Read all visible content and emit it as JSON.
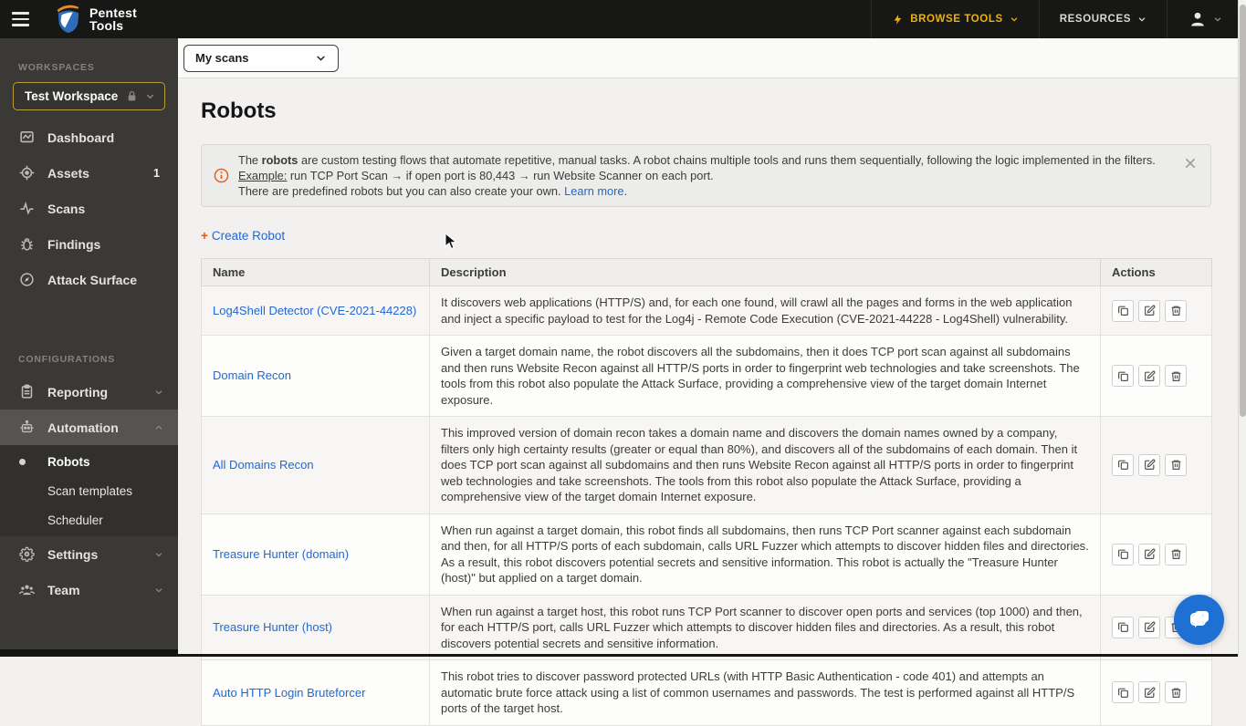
{
  "navbar": {
    "logo_line1": "Pentest",
    "logo_line2": "Tools",
    "browse_tools_label": "BROWSE TOOLS",
    "resources_label": "RESOURCES"
  },
  "sidebar": {
    "workspaces_label": "WORKSPACES",
    "workspace_name": "Test Workspace",
    "items": [
      {
        "label": "Dashboard",
        "badge": ""
      },
      {
        "label": "Assets",
        "badge": "1"
      },
      {
        "label": "Scans",
        "badge": ""
      },
      {
        "label": "Findings",
        "badge": ""
      },
      {
        "label": "Attack Surface",
        "badge": ""
      }
    ],
    "configurations_label": "CONFIGURATIONS",
    "reporting_label": "Reporting",
    "automation_label": "Automation",
    "automation_children": [
      {
        "label": "Robots"
      },
      {
        "label": "Scan templates"
      },
      {
        "label": "Scheduler"
      }
    ],
    "settings_label": "Settings",
    "team_label": "Team"
  },
  "topbar": {
    "scope_selected": "My scans"
  },
  "page": {
    "title": "Robots"
  },
  "info_banner": {
    "line1_pre": "The ",
    "line1_bold": "robots",
    "line1_post": " are custom testing flows that automate repetitive, manual tasks. A robot chains multiple tools and runs them sequentially, following the logic implemented in the filters.",
    "line2_label": "Example:",
    "line2_text": " run TCP Port Scan → if open port is 80,443 → run Website Scanner on each port.",
    "line3_pre": "There are predefined robots but you can also create your own. ",
    "line3_link": "Learn more",
    "line3_post": "."
  },
  "actions_bar": {
    "create_plus": "+",
    "create_label": "Create Robot"
  },
  "table": {
    "headers": {
      "name": "Name",
      "description": "Description",
      "actions": "Actions"
    },
    "rows": [
      {
        "name": "Log4Shell Detector (CVE-2021-44228)",
        "description": "It discovers web applications (HTTP/S) and, for each one found, will crawl all the pages and forms in the web application and inject a specific payload to test for the Log4j - Remote Code Execution (CVE-2021-44228 - Log4Shell) vulnerability."
      },
      {
        "name": "Domain Recon",
        "description": "Given a target domain name, the robot discovers all the subdomains, then it does TCP port scan against all subdomains and then runs Website Recon against all HTTP/S ports in order to fingerprint web technologies and take screenshots. The tools from this robot also populate the Attack Surface, providing a comprehensive view of the target domain Internet exposure."
      },
      {
        "name": "All Domains Recon",
        "description": "This improved version of domain recon takes a domain name and discovers the domain names owned by a company, filters only high certainty results (greater or equal than 80%), and discovers all of the subdomains of each domain. Then it does TCP port scan against all subdomains and then runs Website Recon against all HTTP/S ports in order to fingerprint web technologies and take screenshots. The tools from this robot also populate the Attack Surface, providing a comprehensive view of the target domain Internet exposure."
      },
      {
        "name": "Treasure Hunter (domain)",
        "description": "When run against a target domain, this robot finds all subdomains, then runs TCP Port scanner against each subdomain and then, for all HTTP/S ports of each subdomain, calls URL Fuzzer which attempts to discover hidden files and directories. As a result, this robot discovers potential secrets and sensitive information. This robot is actually the \"Treasure Hunter (host)\" but applied on a target domain."
      },
      {
        "name": "Treasure Hunter (host)",
        "description": "When run against a target host, this robot runs TCP Port scanner to discover open ports and services (top 1000) and then, for each HTTP/S port, calls URL Fuzzer which attempts to discover hidden files and directories. As a result, this robot discovers potential secrets and sensitive information."
      },
      {
        "name": "Auto HTTP Login Bruteforcer",
        "description": "This robot tries to discover password protected URLs (with HTTP Basic Authentication - code 401) and attempts an automatic brute force attack using a list of common usernames and passwords. The test is performed against all HTTP/S ports of the target host."
      }
    ]
  },
  "colors": {
    "accent_yellow": "#eab312",
    "link_blue": "#2268d1",
    "orange": "#e8590c",
    "navbar_bg": "#171716",
    "sidebar_bg": "#3a3936",
    "chat_blue": "#1f70d3"
  }
}
